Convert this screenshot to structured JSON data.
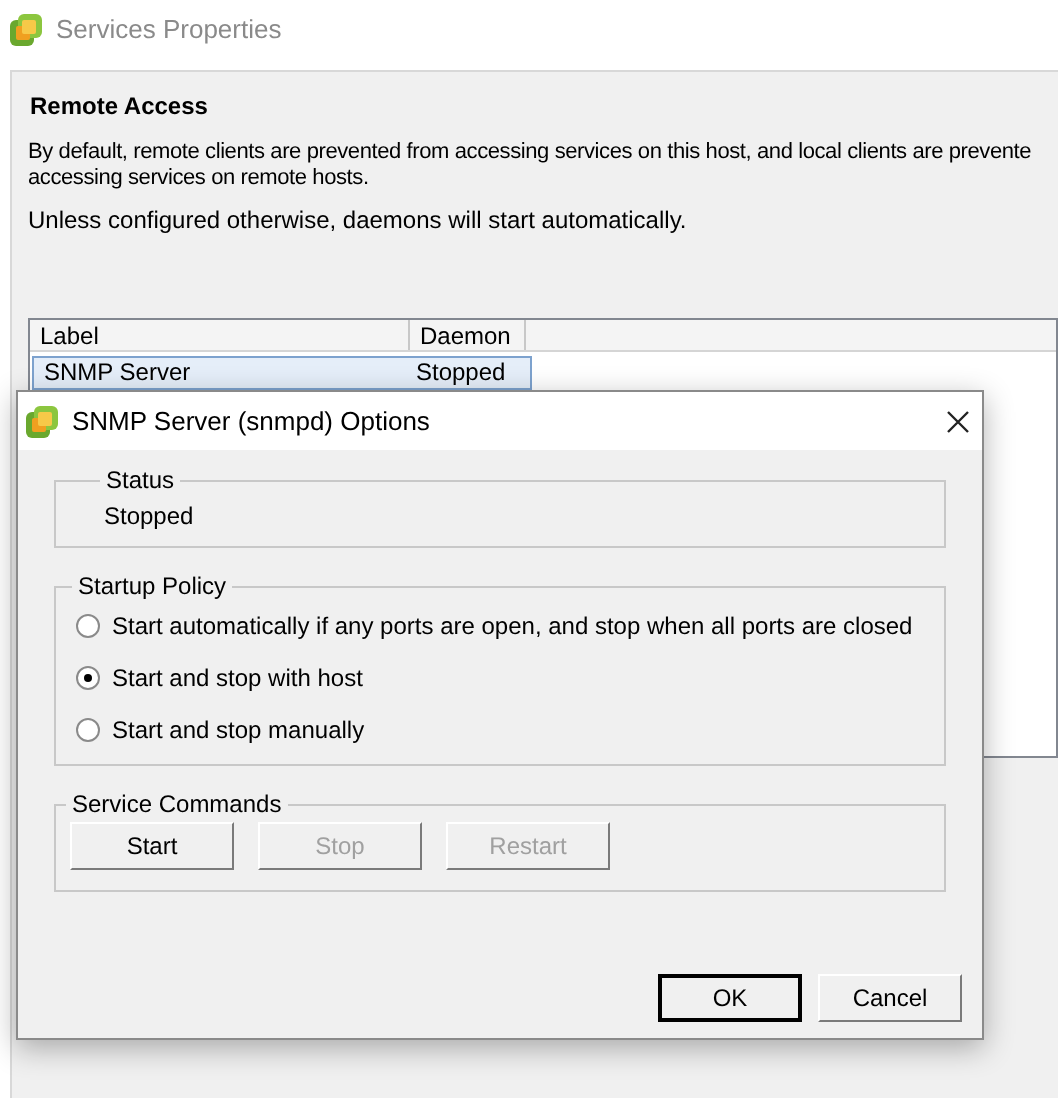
{
  "window": {
    "title": "Services Properties"
  },
  "remote_access": {
    "heading": "Remote Access",
    "description_lines": [
      "By default, remote clients are prevented from accessing services on this host, and local clients are prevente",
      "accessing services on remote hosts."
    ],
    "note": "Unless configured otherwise, daemons will start automatically."
  },
  "table": {
    "columns": [
      "Label",
      "Daemon"
    ],
    "rows": [
      {
        "label": "SNMP Server",
        "daemon": "Stopped",
        "selected": true
      }
    ]
  },
  "dialog": {
    "title": "SNMP Server (snmpd) Options",
    "status": {
      "title": "Status",
      "value": "Stopped"
    },
    "startup_policy": {
      "title": "Startup Policy",
      "options": [
        {
          "label": "Start automatically if any ports are open, and stop when all ports are closed",
          "selected": false
        },
        {
          "label": "Start and stop with host",
          "selected": true
        },
        {
          "label": "Start and stop manually",
          "selected": false
        }
      ]
    },
    "service_commands": {
      "title": "Service Commands",
      "buttons": [
        {
          "label": "Start",
          "disabled": false
        },
        {
          "label": "Stop",
          "disabled": true
        },
        {
          "label": "Restart",
          "disabled": true
        }
      ]
    },
    "buttons": [
      {
        "label": "OK",
        "default": true
      },
      {
        "label": "Cancel",
        "default": false
      }
    ]
  }
}
